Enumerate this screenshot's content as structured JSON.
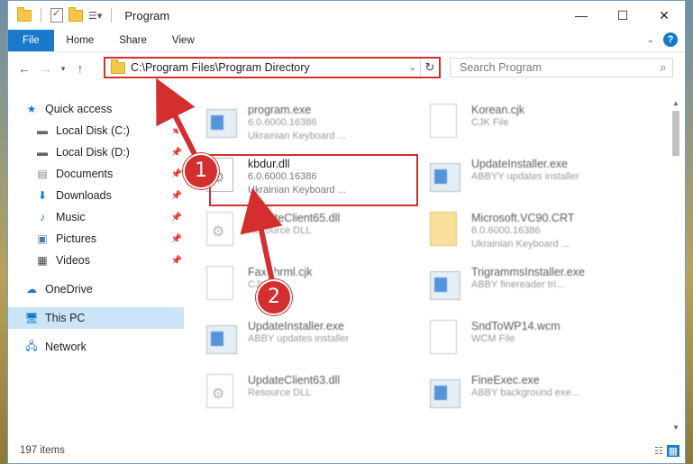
{
  "titlebar": {
    "title": "Program"
  },
  "ribbon": {
    "tabs": [
      "File",
      "Home",
      "Share",
      "View"
    ],
    "help": "?"
  },
  "address": {
    "path": "C:\\Program Files\\Program Directory"
  },
  "search": {
    "placeholder": "Search Program"
  },
  "nav": {
    "items": [
      {
        "label": "Quick access",
        "icon": "star-icon"
      },
      {
        "label": "Local Disk (C:)",
        "icon": "drive-icon",
        "pinned": true
      },
      {
        "label": "Local Disk (D:)",
        "icon": "drive-icon",
        "pinned": true
      },
      {
        "label": "Documents",
        "icon": "documents-icon",
        "pinned": true
      },
      {
        "label": "Downloads",
        "icon": "downloads-icon",
        "pinned": true
      },
      {
        "label": "Music",
        "icon": "music-icon",
        "pinned": true
      },
      {
        "label": "Pictures",
        "icon": "pictures-icon",
        "pinned": true
      },
      {
        "label": "Videos",
        "icon": "videos-icon",
        "pinned": true
      },
      {
        "label": "OneDrive",
        "icon": "onedrive-icon"
      },
      {
        "label": "This PC",
        "icon": "pc-icon",
        "selected": true
      },
      {
        "label": "Network",
        "icon": "network-icon"
      }
    ]
  },
  "files": [
    {
      "name": "program.exe",
      "line1": "6.0.6000.16386",
      "line2": "Ukrainian Keyboard ...",
      "icon": "app-file-icon"
    },
    {
      "name": "Korean.cjk",
      "line1": "CJK File",
      "line2": "",
      "icon": "document-icon"
    },
    {
      "name": "kbdur.dll",
      "line1": "6.0.6000.16386",
      "line2": "Ukrainian Keyboard ...",
      "icon": "dll-file-icon"
    },
    {
      "name": "UpdateInstaller.exe",
      "line1": "ABBYY updates installer",
      "line2": "",
      "icon": "app-file-icon"
    },
    {
      "name": "UpdateClient65.dll",
      "line1": "Resource DLL",
      "line2": "",
      "icon": "dll-file-icon"
    },
    {
      "name": "Microsoft.VC90.CRT",
      "line1": "6.0.6000.16386",
      "line2": "Ukrainian Keyboard ...",
      "icon": "folder-file-icon"
    },
    {
      "name": "FaxFhrml.cjk",
      "line1": "CJK File",
      "line2": "",
      "icon": "document-icon"
    },
    {
      "name": "TrigrammsInstaller.exe",
      "line1": "ABBY finereader tri...",
      "line2": "",
      "icon": "app-file-icon"
    },
    {
      "name": "UpdateInstaller.exe",
      "line1": "ABBY updates installer",
      "line2": "",
      "icon": "app-file-icon"
    },
    {
      "name": "SndToWP14.wcm",
      "line1": "WCM File",
      "line2": "",
      "icon": "document-icon"
    },
    {
      "name": "UpdateClient63.dll",
      "line1": "Resource DLL",
      "line2": "",
      "icon": "dll-file-icon"
    },
    {
      "name": "FineExec.exe",
      "line1": "ABBY background exe...",
      "line2": "",
      "icon": "app-file-icon"
    }
  ],
  "status": {
    "count": "197 items"
  },
  "annotations": {
    "badge1": "1",
    "badge2": "2"
  },
  "colors": {
    "accent": "#1979ca",
    "highlight": "#d32f2f"
  }
}
